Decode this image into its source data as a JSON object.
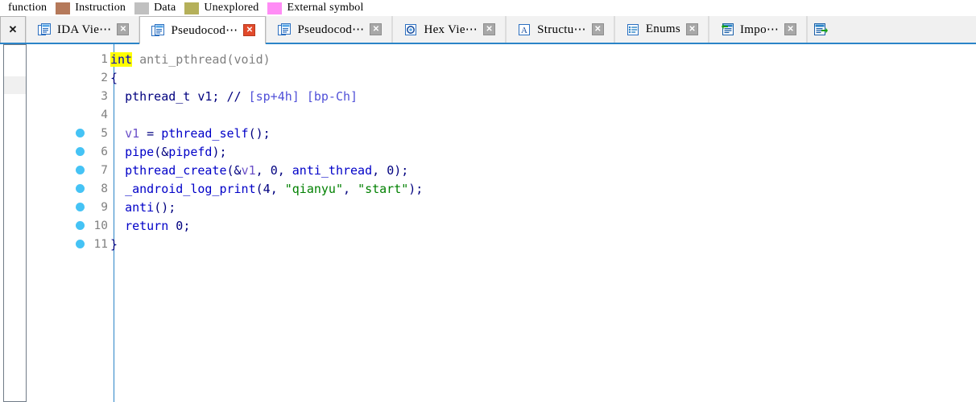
{
  "legend": {
    "leading_label": "function",
    "items": [
      {
        "label": "Instruction",
        "color": "#b5795a"
      },
      {
        "label": "Data",
        "color": "#c0c0c0"
      },
      {
        "label": "Unexplored",
        "color": "#b5b05a"
      },
      {
        "label": "External symbol",
        "color": "#ff8cf5"
      }
    ]
  },
  "tabstrip": {
    "close_all_label": "✕",
    "close_glyph": "✕",
    "overflow_icon": "exports-icon",
    "tabs": [
      {
        "title": "IDA Vie⋯",
        "icon": "ida-view-icon",
        "active": false,
        "closable": true
      },
      {
        "title": "Pseudocod⋯",
        "icon": "pseudocode-icon",
        "active": true,
        "closable": true
      },
      {
        "title": "Pseudocod⋯",
        "icon": "pseudocode-icon",
        "active": false,
        "closable": true
      },
      {
        "title": "Hex Vie⋯",
        "icon": "hex-view-icon",
        "active": false,
        "closable": true
      },
      {
        "title": "Structu⋯",
        "icon": "structures-icon",
        "active": false,
        "closable": true
      },
      {
        "title": "Enums",
        "icon": "enums-icon",
        "active": false,
        "closable": true
      },
      {
        "title": "Impo⋯",
        "icon": "imports-icon",
        "active": false,
        "closable": true
      }
    ]
  },
  "colors": {
    "accent": "#2b84c8",
    "breakpoint_dot": "#45c3f5",
    "highlight": "#ffff00",
    "string": "#008000",
    "comment": "#5050d8",
    "variable": "#6a4fc8",
    "function": "#0000c8",
    "identifier_gray": "#808080"
  },
  "code": {
    "lines": [
      {
        "n": "1",
        "dot": false,
        "tokens": [
          {
            "t": "int",
            "c": "kw"
          },
          {
            "t": " ",
            "c": "plain"
          },
          {
            "t": "anti_pthread",
            "c": "fname"
          },
          {
            "t": "(",
            "c": "fname"
          },
          {
            "t": "void",
            "c": "fname"
          },
          {
            "t": ")",
            "c": "fname"
          }
        ]
      },
      {
        "n": "2",
        "dot": false,
        "tokens": [
          {
            "t": "{",
            "c": "punct"
          }
        ]
      },
      {
        "n": "3",
        "dot": false,
        "tokens": [
          {
            "t": "  ",
            "c": "plain"
          },
          {
            "t": "pthread_t",
            "c": "type"
          },
          {
            "t": " v1; ",
            "c": "punct"
          },
          {
            "t": "// ",
            "c": "punct"
          },
          {
            "t": "[sp+4h] [bp-Ch]",
            "c": "cmt"
          }
        ]
      },
      {
        "n": "4",
        "dot": false,
        "tokens": []
      },
      {
        "n": "5",
        "dot": true,
        "tokens": [
          {
            "t": "  ",
            "c": "plain"
          },
          {
            "t": "v1",
            "c": "var"
          },
          {
            "t": " = ",
            "c": "punct"
          },
          {
            "t": "pthread_self",
            "c": "func"
          },
          {
            "t": "();",
            "c": "punct"
          }
        ]
      },
      {
        "n": "6",
        "dot": true,
        "tokens": [
          {
            "t": "  ",
            "c": "plain"
          },
          {
            "t": "pipe",
            "c": "func"
          },
          {
            "t": "(&",
            "c": "punct"
          },
          {
            "t": "pipefd",
            "c": "func"
          },
          {
            "t": ");",
            "c": "punct"
          }
        ]
      },
      {
        "n": "7",
        "dot": true,
        "tokens": [
          {
            "t": "  ",
            "c": "plain"
          },
          {
            "t": "pthread_create",
            "c": "func"
          },
          {
            "t": "(&",
            "c": "punct"
          },
          {
            "t": "v1",
            "c": "var"
          },
          {
            "t": ", ",
            "c": "punct"
          },
          {
            "t": "0",
            "c": "num"
          },
          {
            "t": ", ",
            "c": "punct"
          },
          {
            "t": "anti_thread",
            "c": "func"
          },
          {
            "t": ", ",
            "c": "punct"
          },
          {
            "t": "0",
            "c": "num"
          },
          {
            "t": ");",
            "c": "punct"
          }
        ]
      },
      {
        "n": "8",
        "dot": true,
        "tokens": [
          {
            "t": "  ",
            "c": "plain"
          },
          {
            "t": "_android_log_print",
            "c": "func"
          },
          {
            "t": "(",
            "c": "punct"
          },
          {
            "t": "4",
            "c": "num"
          },
          {
            "t": ", ",
            "c": "punct"
          },
          {
            "t": "\"qianyu\"",
            "c": "str"
          },
          {
            "t": ", ",
            "c": "punct"
          },
          {
            "t": "\"start\"",
            "c": "str"
          },
          {
            "t": ");",
            "c": "punct"
          }
        ]
      },
      {
        "n": "9",
        "dot": true,
        "tokens": [
          {
            "t": "  ",
            "c": "plain"
          },
          {
            "t": "anti",
            "c": "func"
          },
          {
            "t": "();",
            "c": "punct"
          }
        ]
      },
      {
        "n": "10",
        "dot": true,
        "tokens": [
          {
            "t": "  ",
            "c": "plain"
          },
          {
            "t": "return",
            "c": "kw2"
          },
          {
            "t": " ",
            "c": "plain"
          },
          {
            "t": "0",
            "c": "num"
          },
          {
            "t": ";",
            "c": "punct"
          }
        ]
      },
      {
        "n": "11",
        "dot": true,
        "tokens": [
          {
            "t": "}",
            "c": "punct"
          }
        ]
      }
    ]
  }
}
